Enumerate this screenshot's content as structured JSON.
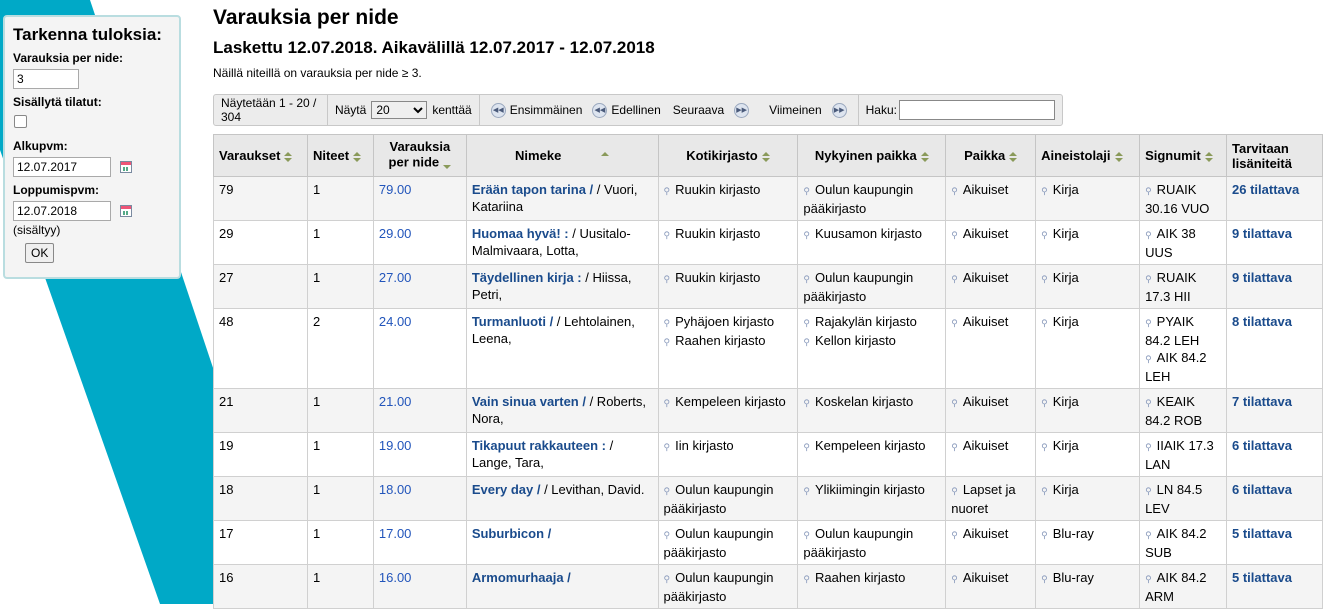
{
  "sidebar": {
    "title": "Tarkenna tuloksia:",
    "per_item_label": "Varauksia per nide:",
    "per_item_value": "3",
    "include_ordered_label": "Sisällytä tilatut:",
    "start_label": "Alkupvm:",
    "start_value": "12.07.2017",
    "end_label": "Loppumispvm:",
    "end_value": "12.07.2018",
    "included_note": "(sisältyy)",
    "ok_label": "OK"
  },
  "header": {
    "title": "Varauksia per nide",
    "subtitle": "Laskettu 12.07.2018. Aikavälillä 12.07.2017 - 12.07.2018",
    "description": "Näillä niteillä on varauksia per nide ≥ 3."
  },
  "pager": {
    "showing": "Näytetään 1 - 20 / 304",
    "show_label": "Näytä",
    "page_size": "20",
    "fields_label": "kenttää",
    "first": "Ensimmäinen",
    "prev": "Edellinen",
    "next": "Seuraava",
    "last": "Viimeinen",
    "search_label": "Haku:"
  },
  "table": {
    "headers": [
      "Varaukset",
      "Niteet",
      "Varauksia per nide",
      "Nimeke",
      "Kotikirjasto",
      "Nykyinen paikka",
      "Paikka",
      "Aineistolaji",
      "Signumit",
      "Tarvitaan lisäniteitä"
    ],
    "rows": [
      {
        "holds": "79",
        "items": "1",
        "ratio": "79.00",
        "title": "Erään tapon tarina /",
        "author": " / Vuori, Katariina",
        "home": [
          "Ruukin kirjasto"
        ],
        "current": [
          "Oulun kaupungin pääkirjasto"
        ],
        "location": "Aikuiset",
        "type": "Kirja",
        "callnos": [
          "RUAIK 30.16 VUO"
        ],
        "needed": "26 tilattava"
      },
      {
        "holds": "29",
        "items": "1",
        "ratio": "29.00",
        "title": "Huomaa hyvä! :",
        "author": " / Uusitalo-Malmivaara, Lotta,",
        "home": [
          "Ruukin kirjasto"
        ],
        "current": [
          "Kuusamon kirjasto"
        ],
        "location": "Aikuiset",
        "type": "Kirja",
        "callnos": [
          "AIK 38 UUS"
        ],
        "needed": "9 tilattava"
      },
      {
        "holds": "27",
        "items": "1",
        "ratio": "27.00",
        "title": "Täydellinen kirja :",
        "author": " / Hiissa, Petri,",
        "home": [
          "Ruukin kirjasto"
        ],
        "current": [
          "Oulun kaupungin pääkirjasto"
        ],
        "location": "Aikuiset",
        "type": "Kirja",
        "callnos": [
          "RUAIK 17.3 HII"
        ],
        "needed": "9 tilattava"
      },
      {
        "holds": "48",
        "items": "2",
        "ratio": "24.00",
        "title": "Turmanluoti /",
        "author": " / Lehtolainen, Leena,",
        "home": [
          "Pyhäjoen kirjasto",
          "Raahen kirjasto"
        ],
        "current": [
          "Rajakylän kirjasto",
          "Kellon kirjasto"
        ],
        "location": "Aikuiset",
        "type": "Kirja",
        "callnos": [
          "PYAIK 84.2 LEH",
          "AIK 84.2 LEH"
        ],
        "needed": "8 tilattava"
      },
      {
        "holds": "21",
        "items": "1",
        "ratio": "21.00",
        "title": "Vain sinua varten /",
        "author": " / Roberts, Nora,",
        "home": [
          "Kempeleen kirjasto"
        ],
        "current": [
          "Koskelan kirjasto"
        ],
        "location": "Aikuiset",
        "type": "Kirja",
        "callnos": [
          "KEAIK 84.2 ROB"
        ],
        "needed": "7 tilattava"
      },
      {
        "holds": "19",
        "items": "1",
        "ratio": "19.00",
        "title": "Tikapuut rakkauteen :",
        "author": " / Lange, Tara,",
        "home": [
          "Iin kirjasto"
        ],
        "current": [
          "Kempeleen kirjasto"
        ],
        "location": "Aikuiset",
        "type": "Kirja",
        "callnos": [
          "IIAIK 17.3 LAN"
        ],
        "needed": "6 tilattava"
      },
      {
        "holds": "18",
        "items": "1",
        "ratio": "18.00",
        "title": "Every day /",
        "author": " / Levithan, David.",
        "home": [
          "Oulun kaupungin pääkirjasto"
        ],
        "current": [
          "Ylikiimingin kirjasto"
        ],
        "location": "Lapset ja nuoret",
        "type": "Kirja",
        "callnos": [
          "LN 84.5 LEV"
        ],
        "needed": "6 tilattava"
      },
      {
        "holds": "17",
        "items": "1",
        "ratio": "17.00",
        "title": "Suburbicon /",
        "author": "",
        "home": [
          "Oulun kaupungin pääkirjasto"
        ],
        "current": [
          "Oulun kaupungin pääkirjasto"
        ],
        "location": "Aikuiset",
        "type": "Blu-ray",
        "callnos": [
          "AIK 84.2 SUB"
        ],
        "needed": "5 tilattava"
      },
      {
        "holds": "16",
        "items": "1",
        "ratio": "16.00",
        "title": "Armomurhaaja /",
        "author": "",
        "home": [
          "Oulun kaupungin pääkirjasto"
        ],
        "current": [
          "Raahen kirjasto"
        ],
        "location": "Aikuiset",
        "type": "Blu-ray",
        "callnos": [
          "AIK 84.2 ARM"
        ],
        "needed": "5 tilattava"
      }
    ]
  },
  "colors": {
    "stripe": "#00a9c7",
    "link": "#1a4b8c",
    "ratio": "#2255bb"
  }
}
